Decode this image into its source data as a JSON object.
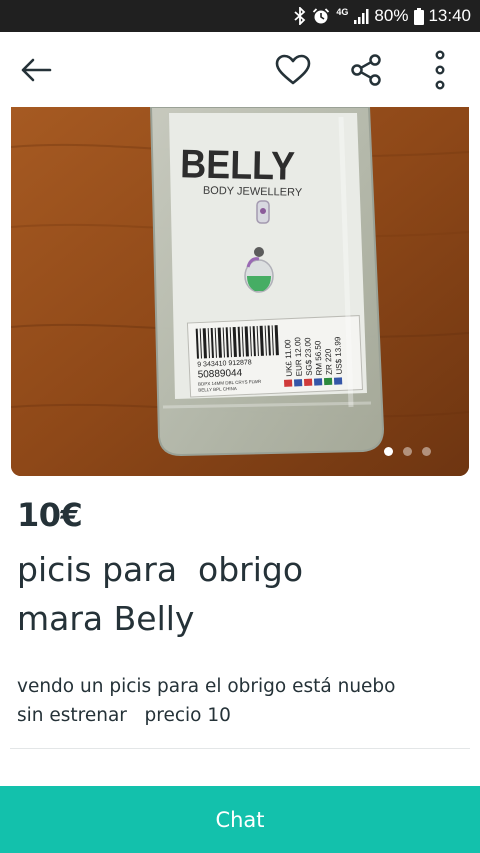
{
  "status_bar": {
    "network": "4G",
    "battery": "80%",
    "time": "13:40",
    "icons": [
      "bluetooth-icon",
      "alarm-icon",
      "signal-icon",
      "battery-icon"
    ]
  },
  "header": {
    "icons": [
      "back-arrow-icon",
      "heart-icon",
      "share-icon",
      "more-vert-icon"
    ]
  },
  "photo": {
    "brand": "BELLY",
    "brand_sub": "BODY JEWELLERY",
    "barcode_number": "9 343410 912878",
    "product_code": "50889044",
    "product_desc_line1": "BDPX 14MM DBL CRYS FLWR",
    "product_desc_line2": "BELLY BPL CHINA",
    "prices": [
      {
        "currency": "UK£",
        "amount": "11.00"
      },
      {
        "currency": "EUR",
        "amount": "12.00"
      },
      {
        "currency": "SG$",
        "amount": "23.00"
      },
      {
        "currency": "RM",
        "amount": "56.50"
      },
      {
        "currency": "ZR",
        "amount": "220"
      },
      {
        "currency": "US$",
        "amount": "13.99"
      }
    ],
    "carousel_pages": 3,
    "carousel_active_index": 0
  },
  "listing": {
    "price": "10€",
    "title": "picis para  obrigo\nmara Belly",
    "description": "vendo un picis para el obrigo está nuebo\nsin estrenar   precio 10"
  },
  "chat": {
    "label": "Chat"
  },
  "colors": {
    "accent": "#13c1ac",
    "text": "#253238",
    "status_bar": "#202020"
  }
}
